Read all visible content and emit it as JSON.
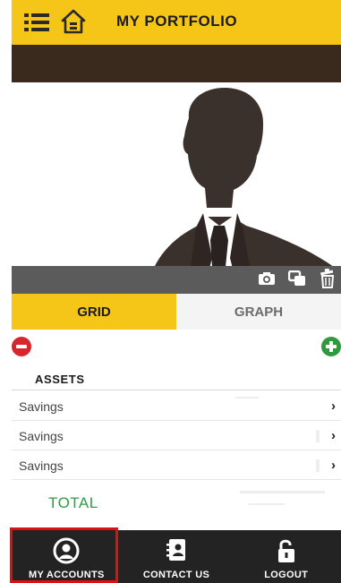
{
  "header": {
    "title": "MY PORTFOLIO",
    "background_color": "#f5c518",
    "menu_icon": "list-menu-icon",
    "home_icon": "home-icon"
  },
  "profile": {
    "photo": "person-silhouette",
    "tools": [
      "camera-icon",
      "copy-icon",
      "trash-icon"
    ]
  },
  "tabs": {
    "items": [
      {
        "label": "GRID",
        "active": true
      },
      {
        "label": "GRAPH",
        "active": false
      }
    ]
  },
  "actions": {
    "remove_icon": "remove-icon",
    "add_icon": "add-icon",
    "remove_color": "#d8262f",
    "add_color": "#2f9a3a"
  },
  "assets": {
    "heading": "ASSETS",
    "rows": [
      {
        "label": "Savings"
      },
      {
        "label": "Savings"
      },
      {
        "label": "Savings"
      }
    ],
    "total_label": "TOTAL",
    "total_color": "#2e9d48"
  },
  "bottom_nav": {
    "items": [
      {
        "label": "MY ACCOUNTS",
        "icon": "user-circle-icon",
        "highlighted": true
      },
      {
        "label": "CONTACT US",
        "icon": "contact-card-icon",
        "highlighted": false
      },
      {
        "label": "LOGOUT",
        "icon": "unlock-icon",
        "highlighted": false
      }
    ],
    "highlight_color": "#e01010"
  }
}
